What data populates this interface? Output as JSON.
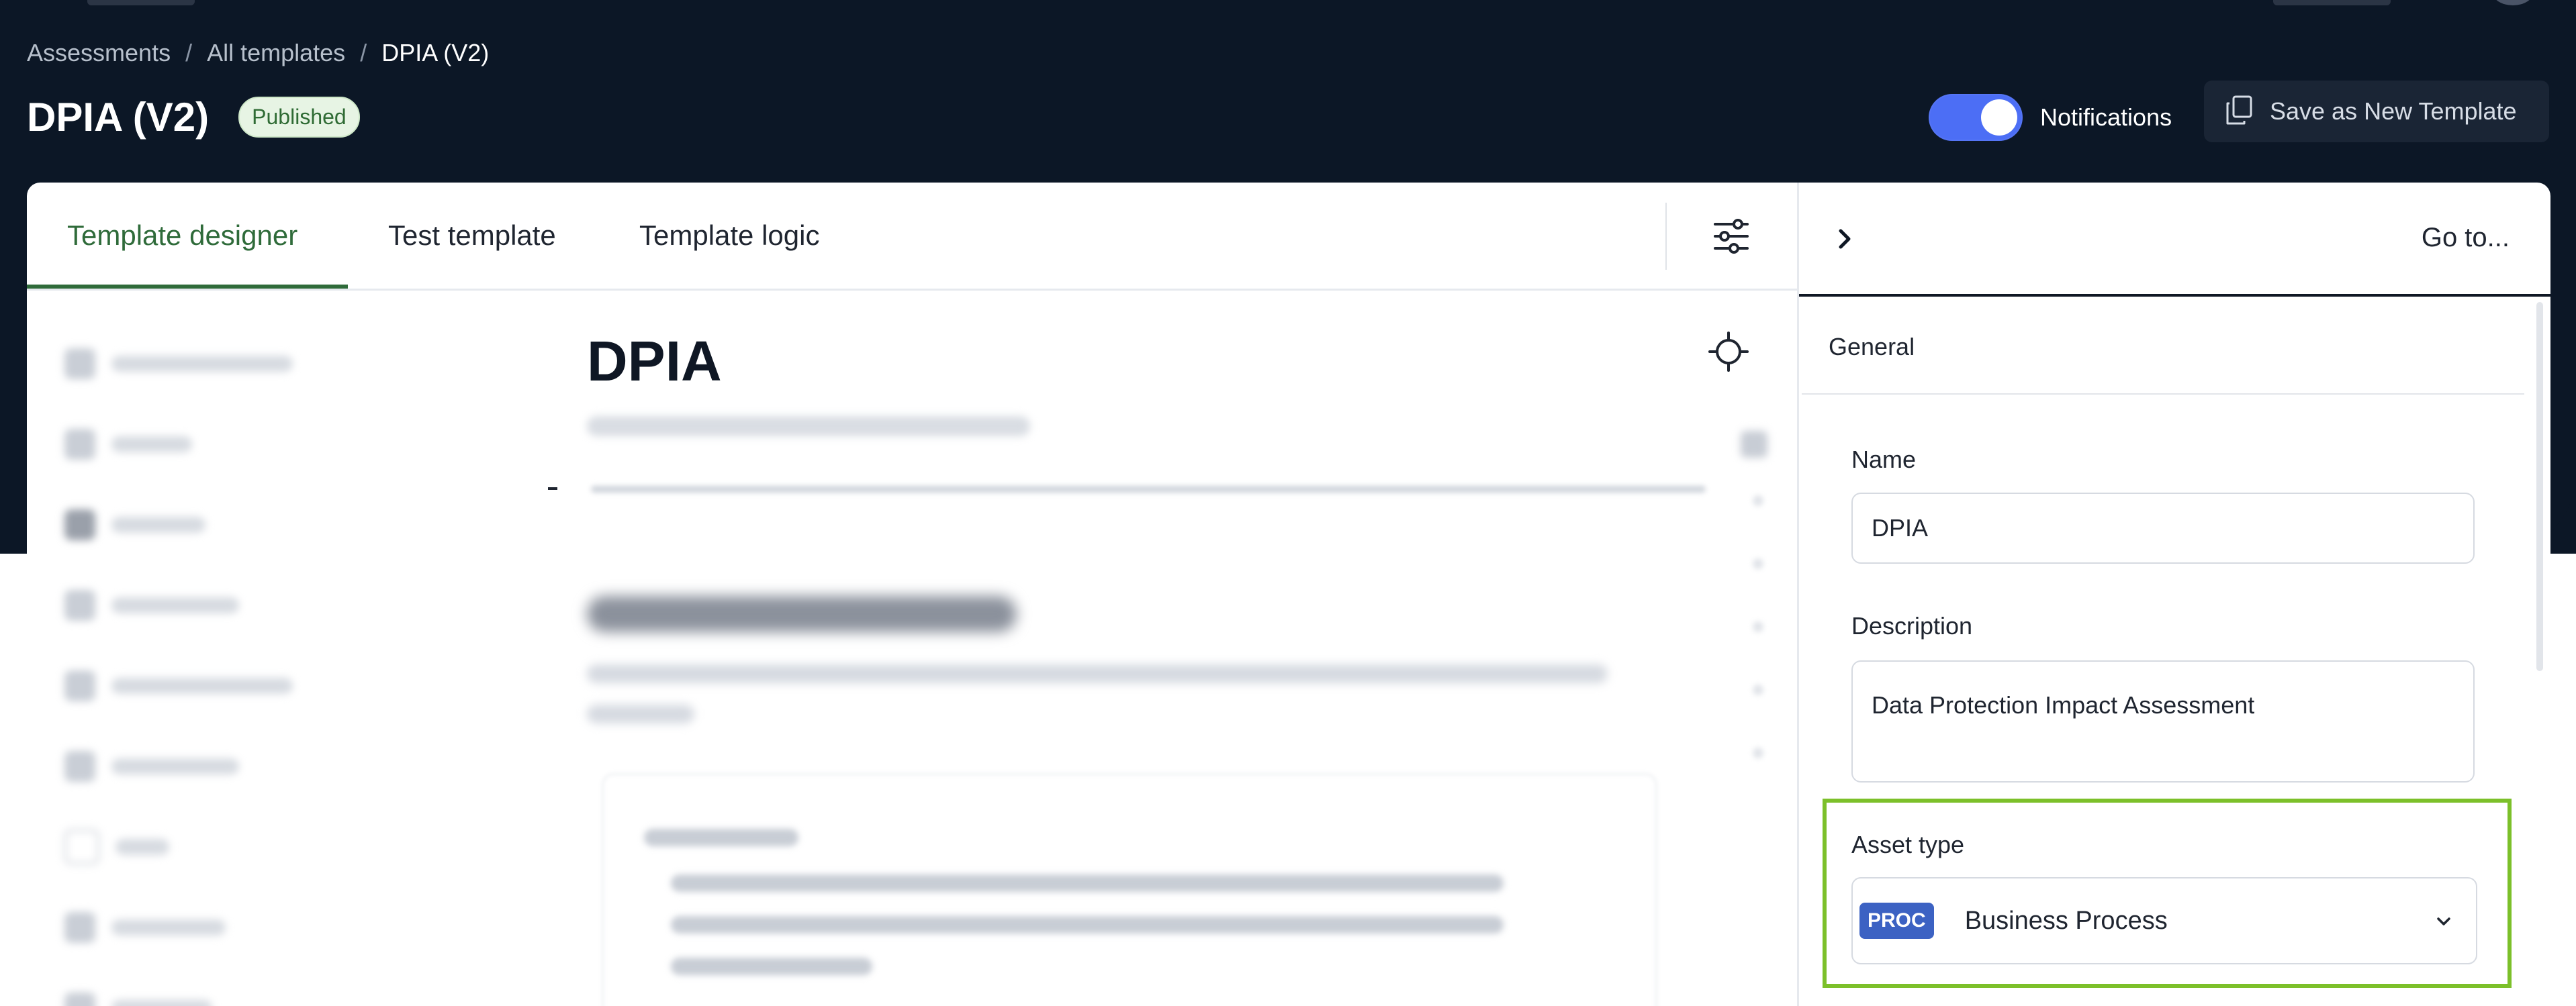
{
  "breadcrumb": {
    "items": [
      "Assessments",
      "All templates",
      "DPIA (V2)"
    ],
    "separator": "/"
  },
  "header": {
    "title": "DPIA (V2)",
    "status_badge": "Published",
    "notifications_label": "Notifications",
    "notifications_on": true,
    "save_button_label": "Save as New Template"
  },
  "tabs": [
    {
      "label": "Template designer",
      "active": true
    },
    {
      "label": "Test template",
      "active": false
    },
    {
      "label": "Template logic",
      "active": false
    }
  ],
  "document": {
    "title": "DPIA"
  },
  "side_panel": {
    "goto_label": "Go to...",
    "section": "General",
    "name_label": "Name",
    "name_value": "DPIA",
    "description_label": "Description",
    "description_value": "Data Protection Impact Assessment",
    "asset_type_label": "Asset type",
    "asset_type_tag": "PROC",
    "asset_type_value": "Business Process"
  },
  "colors": {
    "header_bg": "#0c1726",
    "accent_green": "#2f6b3a",
    "toggle_blue": "#4c6ef5",
    "highlight_green": "#7cc02a",
    "proc_tag_blue": "#3c62c3"
  }
}
